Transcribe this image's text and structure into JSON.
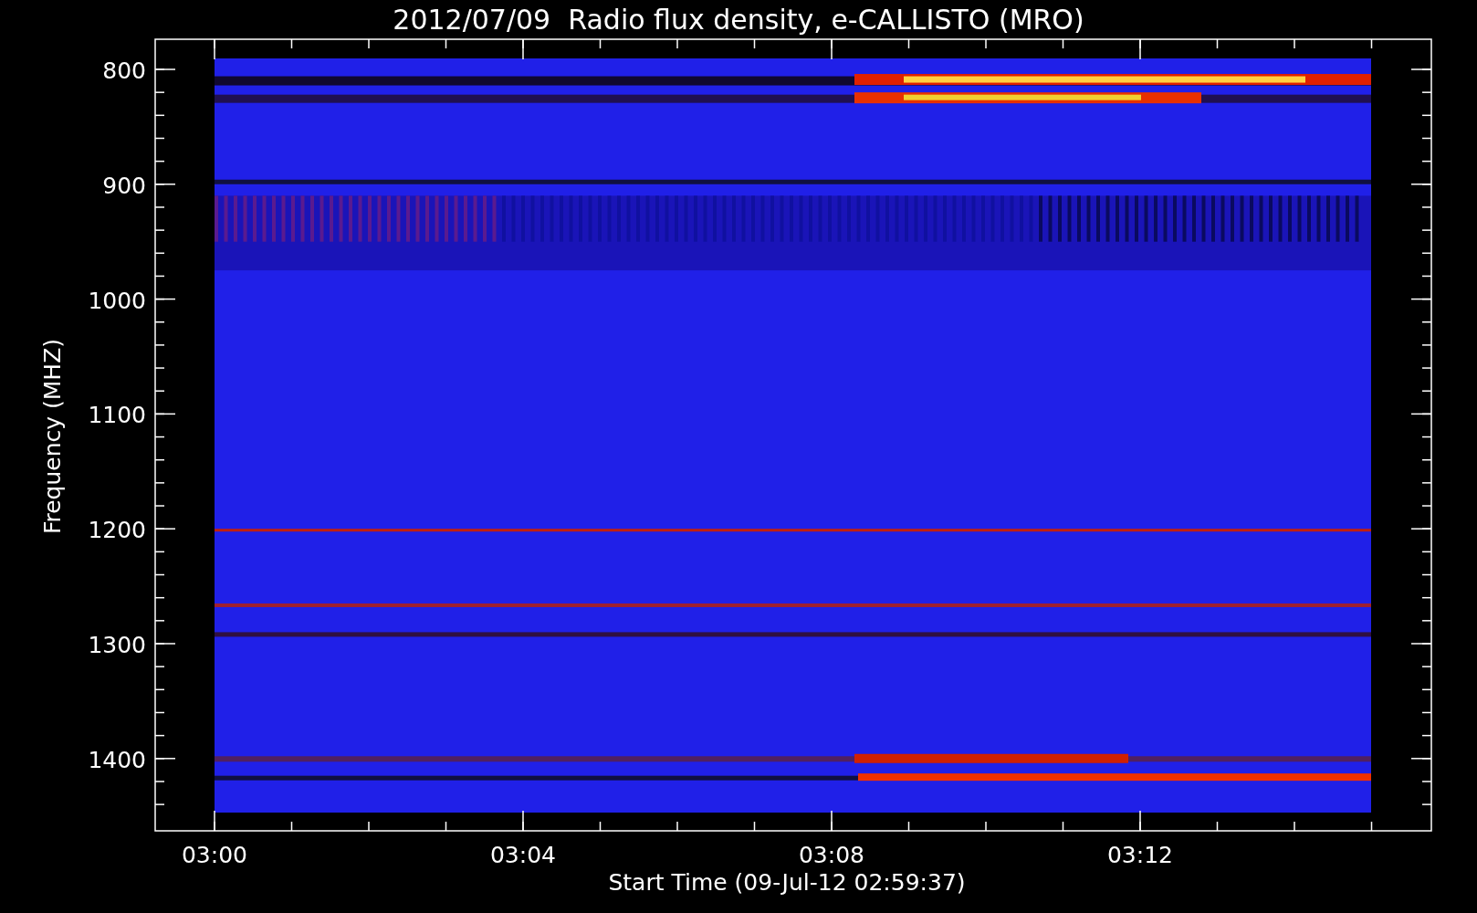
{
  "title": "2012/07/09  Radio flux density, e-CALLISTO (MRO)",
  "y_axis": {
    "label": "Frequency (MHZ)",
    "ticks": [
      "800",
      "900",
      "1000",
      "1100",
      "1200",
      "1300",
      "1400"
    ]
  },
  "x_axis": {
    "label": "Start Time (09-Jul-12 02:59:37)",
    "ticks": [
      "03:00",
      "03:04",
      "03:08",
      "03:12"
    ]
  }
}
